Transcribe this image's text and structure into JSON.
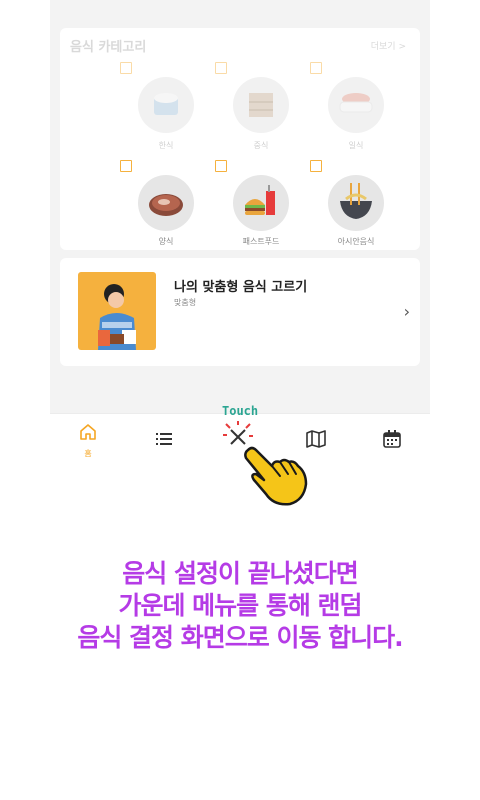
{
  "category_section": {
    "title": "음식 카테고리",
    "more_label": "더보기 >",
    "items": [
      {
        "label": "한식",
        "icon": "rice-bowl-icon"
      },
      {
        "label": "중식",
        "icon": "dumpling-steamer-icon"
      },
      {
        "label": "일식",
        "icon": "sushi-icon"
      },
      {
        "label": "양식",
        "icon": "steak-icon"
      },
      {
        "label": "패스트푸드",
        "icon": "burger-fries-icon"
      },
      {
        "label": "아시안음식",
        "icon": "noodle-bowl-icon"
      }
    ]
  },
  "recommend_card": {
    "title": "나의 맞춤형 음식 고르기",
    "subtitle": "맞춤형"
  },
  "bottom_nav": {
    "items": [
      {
        "label": "홈",
        "icon": "home-icon"
      },
      {
        "label": "",
        "icon": "list-icon"
      },
      {
        "label": "",
        "icon": "random-food-icon"
      },
      {
        "label": "",
        "icon": "map-icon"
      },
      {
        "label": "",
        "icon": "calendar-icon"
      }
    ],
    "active_color": "#f5a623"
  },
  "tutorial": {
    "touch_label": "Touch",
    "lines": [
      "음식 설정이 끝나셨다면",
      "가운데 메뉴를 통해 랜덤",
      "음식 결정 화면으로 이동 합니다."
    ],
    "text_color": "#b53be6"
  }
}
